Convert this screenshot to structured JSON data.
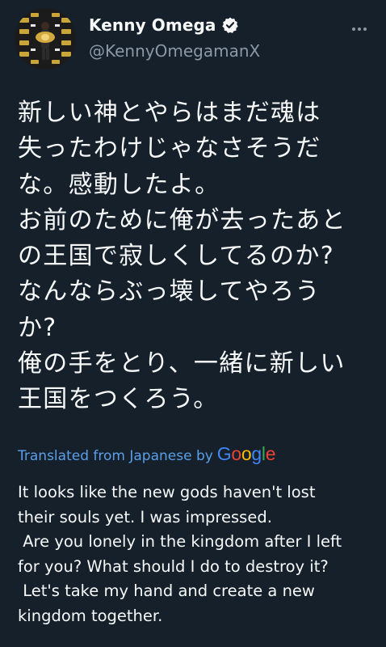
{
  "tweet": {
    "author": {
      "display_name": "Kenny Omega",
      "handle": "@KennyOmegamanX",
      "verified": true
    },
    "original_lines": [
      "新しい神とやらはまだ魂は",
      "失ったわけじゃなさそうだ",
      "な。感動したよ。",
      "お前のために俺が去ったあと",
      "の王国で寂しくしてるのか?",
      "なんならぶっ壊してやろう",
      "か?",
      "俺の手をとり、一緒に新しい",
      "王国をつくろう。"
    ],
    "translation": {
      "label": "Translated from Japanese by",
      "provider_letters": [
        "G",
        "o",
        "o",
        "g",
        "l",
        "e"
      ],
      "lines": [
        "It looks like the new gods haven't lost",
        "their souls yet. I was impressed.",
        " Are you lonely in the kingdom after I left",
        "for you? What should I do to destroy it?",
        " Let's take my hand and create a new",
        "kingdom together."
      ]
    }
  },
  "colors": {
    "background": "#15202b",
    "text_primary": "#f7f9f9",
    "text_secondary": "#8b98a5",
    "link": "#5a9fe8",
    "verified_badge": "#f7f9f9"
  },
  "icons": {
    "verified": "verified-badge-icon",
    "more": "more-options-icon"
  }
}
